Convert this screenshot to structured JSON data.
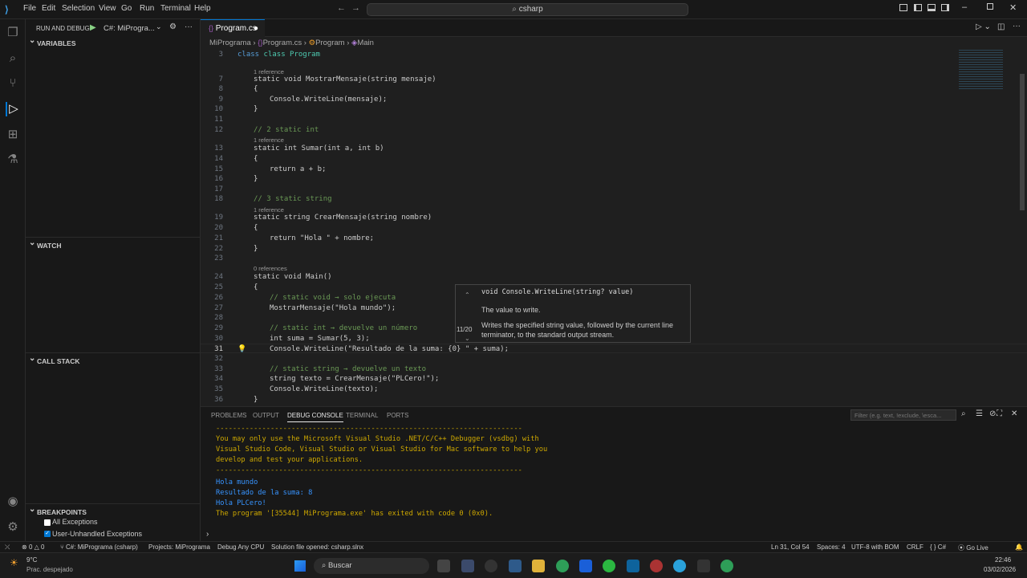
{
  "menu": [
    "File",
    "Edit",
    "Selection",
    "View",
    "Go",
    "Run",
    "Terminal",
    "Help"
  ],
  "command_center": "csharp",
  "sidebar": {
    "title": "RUN AND DEBUG",
    "config": "C#: MiProgra...",
    "variables": "VARIABLES",
    "watch": "WATCH",
    "call_stack": "CALL STACK",
    "breakpoints": "BREAKPOINTS",
    "bp_items": [
      "All Exceptions",
      "User-Unhandled Exceptions"
    ]
  },
  "tab": {
    "label": "Program.cs"
  },
  "breadcrumb": [
    "MiPrograma",
    "Program.cs",
    "Program",
    "Main"
  ],
  "code": {
    "l3": "class Program",
    "l7": "static void MostrarMensaje(string mensaje)",
    "l9": "Console.WriteLine(mensaje);",
    "l12": "// 2 static int",
    "l13": "static int Sumar(int a, int b)",
    "l15": "return a + b;",
    "l18": "// 3 static string",
    "l19": "static string CrearMensaje(string nombre)",
    "l21": "return \"Hola \" + nombre;",
    "l24": "static void Main()",
    "l26": "// static void → solo ejecuta",
    "l27": "MostrarMensaje(\"Hola mundo\");",
    "l29": "// static int → devuelve un número",
    "l30": "int suma = Sumar(5, 3);",
    "l31": "Console.WriteLine(\"Resultado de la suma: {0} \" + suma);",
    "l33": "// static string → devuelve un texto",
    "l34": "string texto = CrearMensaje(\"PLCero!\");",
    "l35": "Console.WriteLine(texto);",
    "ref1": "1 reference",
    "ref0": "0 references"
  },
  "hover": {
    "signature": "void Console.WriteLine(string? value)",
    "param": "The value to write.",
    "desc": "Writes the specified string value, followed by the current line terminator, to the standard output stream.",
    "counter": "11/20"
  },
  "panel": {
    "tabs": [
      "PROBLEMS",
      "OUTPUT",
      "DEBUG CONSOLE",
      "TERMINAL",
      "PORTS"
    ],
    "filter_placeholder": "Filter (e.g. text, !exclude, \\esca...",
    "console": [
      "-------------------------------------------------------------------------",
      "You may only use the Microsoft Visual Studio .NET/C/C++ Debugger (vsdbg) with",
      "Visual Studio Code, Visual Studio or Visual Studio for Mac software to help you",
      "develop and test your applications.",
      "-------------------------------------------------------------------------",
      "Hola mundo",
      "Resultado de la suma: 8",
      "Hola PLCero!",
      "The program '[35544] MiPrograma.exe' has exited with code 0 (0x0)."
    ]
  },
  "status": {
    "errors": "0",
    "warnings": "0",
    "project": "C#: MiPrograma (csharp)",
    "projects": "Projects: MiPrograma",
    "debug": "Debug Any CPU",
    "solution": "Solution file opened: csharp.slnx",
    "position": "Ln 31, Col 54",
    "spaces": "Spaces: 4",
    "encoding": "UTF-8 with BOM",
    "eol": "CRLF",
    "lang": "C#",
    "golive": "Go Live"
  },
  "taskbar": {
    "temp": "9°C",
    "weather": "Prac. despejado",
    "search": "Buscar",
    "time": "22:46",
    "date": "03/02/2026"
  }
}
